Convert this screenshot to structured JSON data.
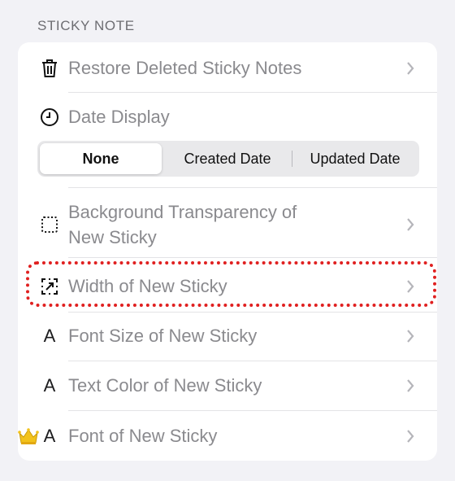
{
  "section": {
    "title": "STICKY NOTE"
  },
  "rows": [
    {
      "label": "Restore Deleted Sticky Notes",
      "icon": "trash-icon"
    },
    {
      "label": "Date Display",
      "icon": "clock-icon"
    },
    {
      "label": "Background Transparency of\nNew Sticky",
      "icon": "dotted-square-icon"
    },
    {
      "label": "Width of New Sticky",
      "icon": "resize-arrow-icon"
    },
    {
      "label": "Font Size of New Sticky",
      "icon": "letter-a-icon",
      "icon_text": "A"
    },
    {
      "label": "Text Color of New Sticky",
      "icon": "letter-a-icon",
      "icon_text": "A"
    },
    {
      "label": "Font of New Sticky",
      "icon": "letter-a-icon",
      "icon_text": "A",
      "premium_icon": "crown-icon"
    }
  ],
  "date_display": {
    "options": [
      "None",
      "Created Date",
      "Updated Date"
    ],
    "selected": "None"
  },
  "colors": {
    "background": "#f2f2f6",
    "card": "#ffffff",
    "label": "#8a8a8e",
    "highlight": "#e02020",
    "crown": "#f2c21b"
  }
}
